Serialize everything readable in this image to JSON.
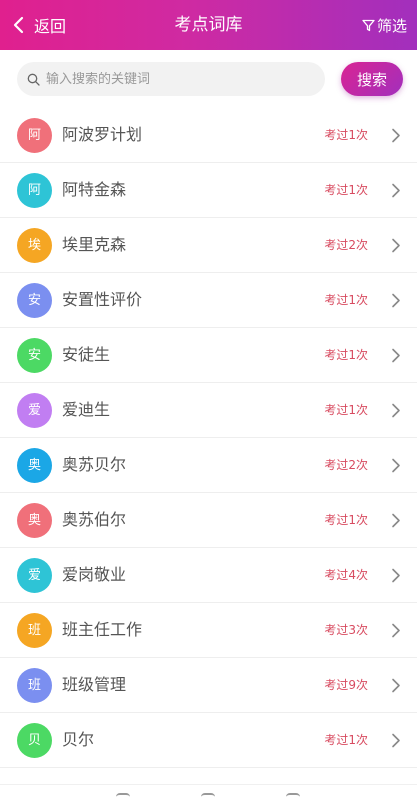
{
  "colors": {
    "header_gradient_start": "#e0208e",
    "header_gradient_end": "#a22fbd",
    "count_text": "#d84b60",
    "word_text": "#555555"
  },
  "header": {
    "back_label": "返回",
    "title": "考点词库",
    "filter_label": "筛选",
    "back_icon": "chevron-left-icon",
    "filter_icon": "funnel-icon"
  },
  "search": {
    "placeholder": "输入搜索的关键词",
    "value": "",
    "button_label": "搜索",
    "icon": "search-icon"
  },
  "items": [
    {
      "initial": "阿",
      "word": "阿波罗计划",
      "count": "考过1次",
      "color": "#f0707a"
    },
    {
      "initial": "阿",
      "word": "阿特金森",
      "count": "考过1次",
      "color": "#2ec4d6"
    },
    {
      "initial": "埃",
      "word": "埃里克森",
      "count": "考过2次",
      "color": "#f5a623"
    },
    {
      "initial": "安",
      "word": "安置性评价",
      "count": "考过1次",
      "color": "#7b8ff0"
    },
    {
      "initial": "安",
      "word": "安徒生",
      "count": "考过1次",
      "color": "#4cd964"
    },
    {
      "initial": "爱",
      "word": "爱迪生",
      "count": "考过1次",
      "color": "#c17ef2"
    },
    {
      "initial": "奥",
      "word": "奥苏贝尔",
      "count": "考过2次",
      "color": "#1ba7e6"
    },
    {
      "initial": "奥",
      "word": "奥苏伯尔",
      "count": "考过1次",
      "color": "#f0707a"
    },
    {
      "initial": "爱",
      "word": "爱岗敬业",
      "count": "考过4次",
      "color": "#2ec4d6"
    },
    {
      "initial": "班",
      "word": "班主任工作",
      "count": "考过3次",
      "color": "#f5a623"
    },
    {
      "initial": "班",
      "word": "班级管理",
      "count": "考过9次",
      "color": "#7b8ff0"
    },
    {
      "initial": "贝",
      "word": "贝尔",
      "count": "考过1次",
      "color": "#4cd964"
    }
  ]
}
